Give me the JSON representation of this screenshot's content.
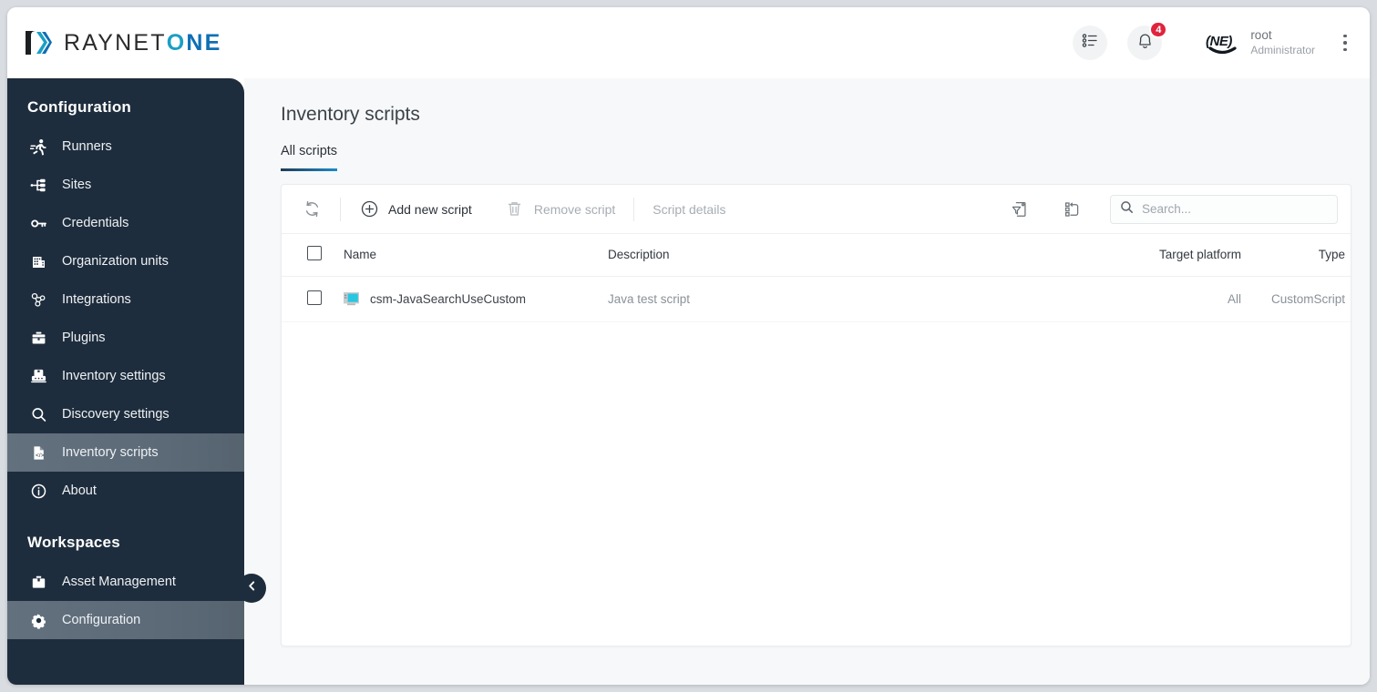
{
  "brand": {
    "name_part1": "RAYNET",
    "name_o": "O",
    "name_ne": "NE",
    "logo_icon": "raynetone-logo-icon"
  },
  "header": {
    "tasks_icon": "task-list-icon",
    "notifications_icon": "bell-icon",
    "notifications_count": "4",
    "avatar_icon": "user-avatar",
    "user_name": "root",
    "user_role": "Administrator",
    "menu_icon": "vertical-dots-icon"
  },
  "sidebar": {
    "section1_title": "Configuration",
    "items": [
      {
        "label": "Runners",
        "icon": "runner-icon"
      },
      {
        "label": "Sites",
        "icon": "sitemap-icon"
      },
      {
        "label": "Credentials",
        "icon": "key-icon"
      },
      {
        "label": "Organization units",
        "icon": "building-icon"
      },
      {
        "label": "Integrations",
        "icon": "integrations-icon"
      },
      {
        "label": "Plugins",
        "icon": "toolbox-icon"
      },
      {
        "label": "Inventory settings",
        "icon": "inventory-settings-icon"
      },
      {
        "label": "Discovery settings",
        "icon": "magnifier-icon"
      },
      {
        "label": "Inventory scripts",
        "icon": "script-file-icon"
      },
      {
        "label": "About",
        "icon": "info-icon"
      }
    ],
    "active_item": "Inventory scripts",
    "section2_title": "Workspaces",
    "workspaces": [
      {
        "label": "Asset Management",
        "icon": "briefcase-icon"
      },
      {
        "label": "Configuration",
        "icon": "gear-icon"
      }
    ],
    "active_workspace": "Configuration",
    "collapse_icon": "chevron-left-icon"
  },
  "main": {
    "page_title": "Inventory scripts",
    "tabs": [
      {
        "label": "All scripts",
        "active": true
      }
    ],
    "toolbar": {
      "refresh_icon": "refresh-icon",
      "add_label": "Add new script",
      "add_icon": "plus-circle-icon",
      "remove_label": "Remove script",
      "remove_icon": "trash-icon",
      "details_label": "Script details",
      "filter_icon": "filter-document-icon",
      "group_icon": "group-columns-icon"
    },
    "search": {
      "placeholder": "Search...",
      "value": "",
      "icon": "search-icon"
    },
    "table": {
      "columns": [
        {
          "key": "name",
          "label": "Name"
        },
        {
          "key": "description",
          "label": "Description"
        },
        {
          "key": "platform",
          "label": "Target platform"
        },
        {
          "key": "type",
          "label": "Type"
        }
      ],
      "rows": [
        {
          "icon": "monitor-icon",
          "name": "csm-JavaSearchUseCustom",
          "description": "Java test script",
          "platform": "All",
          "type": "CustomScript",
          "checked": false
        }
      ]
    }
  },
  "colors": {
    "sidebar_bg": "#1e2d3d",
    "accent_blue": "#1b7fbe",
    "badge_red": "#e0233d",
    "logo_teal": "#1b9fc4",
    "logo_blue": "#0f6fb5"
  }
}
